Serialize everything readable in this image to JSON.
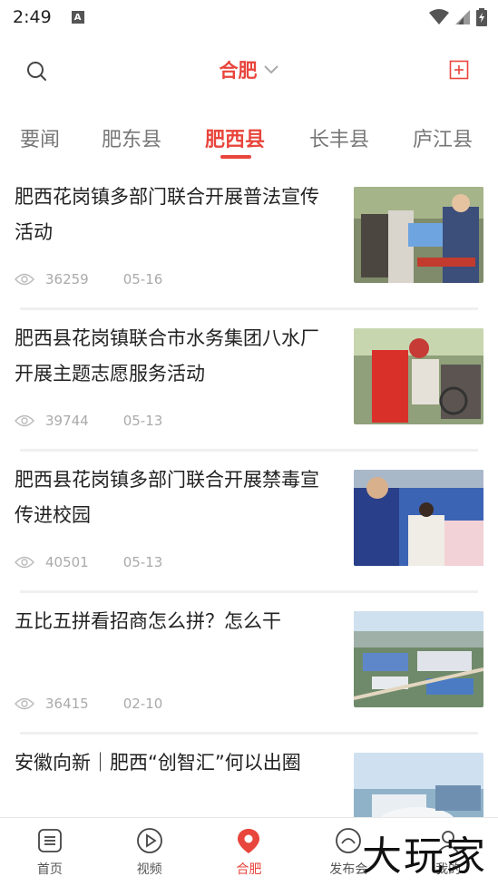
{
  "status_bar": {
    "time": "2:49",
    "notification_icon": "A"
  },
  "header": {
    "city": "合肥"
  },
  "tabs": [
    {
      "label": "要闻"
    },
    {
      "label": "肥东县"
    },
    {
      "label": "肥西县",
      "active": true
    },
    {
      "label": "长丰县"
    },
    {
      "label": "庐江县"
    }
  ],
  "articles": [
    {
      "title": "肥西花岗镇多部门联合开展普法宣传活动",
      "views": "36259",
      "date": "05-16",
      "thumb": "street-outreach-photo"
    },
    {
      "title": "肥西县花岗镇联合市水务集团八水厂开展主题志愿服务活动",
      "views": "39744",
      "date": "05-13",
      "thumb": "volunteer-photo"
    },
    {
      "title": "肥西县花岗镇多部门联合开展禁毒宣传进校园",
      "views": "40501",
      "date": "05-13",
      "thumb": "classroom-photo"
    },
    {
      "title": "五比五拼看招商怎么拼？怎么干",
      "views": "36415",
      "date": "02-10",
      "thumb": "industrial-park-aerial-photo"
    },
    {
      "title": "安徽向新｜肥西“创智汇”何以出圈",
      "views": "",
      "date": "",
      "thumb": "modern-building-photo"
    }
  ],
  "bottom_nav": [
    {
      "label": "首页",
      "icon": "home-icon"
    },
    {
      "label": "视频",
      "icon": "video-play-icon"
    },
    {
      "label": "合肥",
      "icon": "location-pin-icon",
      "active": true
    },
    {
      "label": "发布会",
      "icon": "press-conference-icon"
    },
    {
      "label": "我的",
      "icon": "user-icon"
    }
  ],
  "watermark": "大玩家",
  "colors": {
    "accent": "#e8453c"
  }
}
